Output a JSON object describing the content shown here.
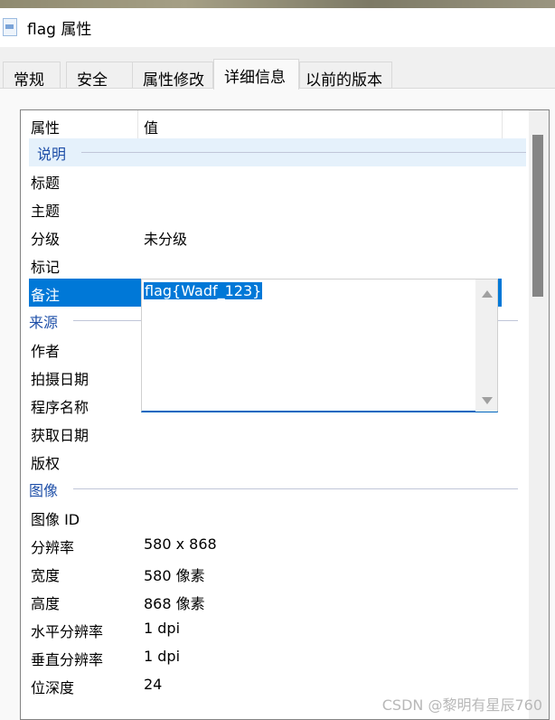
{
  "window": {
    "title": "flag 属性",
    "icon": "jpg-file-icon"
  },
  "tabs": [
    {
      "label": "常规"
    },
    {
      "label": "安全"
    },
    {
      "label": "属性修改"
    },
    {
      "label": "详细信息",
      "active": true
    },
    {
      "label": "以前的版本"
    }
  ],
  "list": {
    "headers": {
      "property": "属性",
      "value": "值"
    },
    "groups": [
      {
        "name": "说明",
        "rows": [
          {
            "k": "标题",
            "v": ""
          },
          {
            "k": "主题",
            "v": ""
          },
          {
            "k": "分级",
            "v": "未分级"
          },
          {
            "k": "标记",
            "v": ""
          },
          {
            "k": "备注",
            "v": "",
            "selected": true
          }
        ]
      },
      {
        "name": "来源",
        "rows": [
          {
            "k": "作者",
            "v": ""
          },
          {
            "k": "拍摄日期",
            "v": ""
          },
          {
            "k": "程序名称",
            "v": ""
          },
          {
            "k": "获取日期",
            "v": ""
          },
          {
            "k": "版权",
            "v": ""
          }
        ]
      },
      {
        "name": "图像",
        "rows": [
          {
            "k": "图像 ID",
            "v": ""
          },
          {
            "k": "分辨率",
            "v": "580 x 868"
          },
          {
            "k": "宽度",
            "v": "580 像素"
          },
          {
            "k": "高度",
            "v": "868 像素"
          },
          {
            "k": "水平分辨率",
            "v": "1 dpi"
          },
          {
            "k": "垂直分辨率",
            "v": "1 dpi"
          },
          {
            "k": "位深度",
            "v": "24"
          }
        ]
      }
    ]
  },
  "editor": {
    "value": "flag{Wadf_123}"
  },
  "colors": {
    "selection": "#0078d7",
    "group_text": "#1e4fa8",
    "group_bg": "#e5f1fb"
  },
  "watermark": "CSDN @黎明有星辰760"
}
